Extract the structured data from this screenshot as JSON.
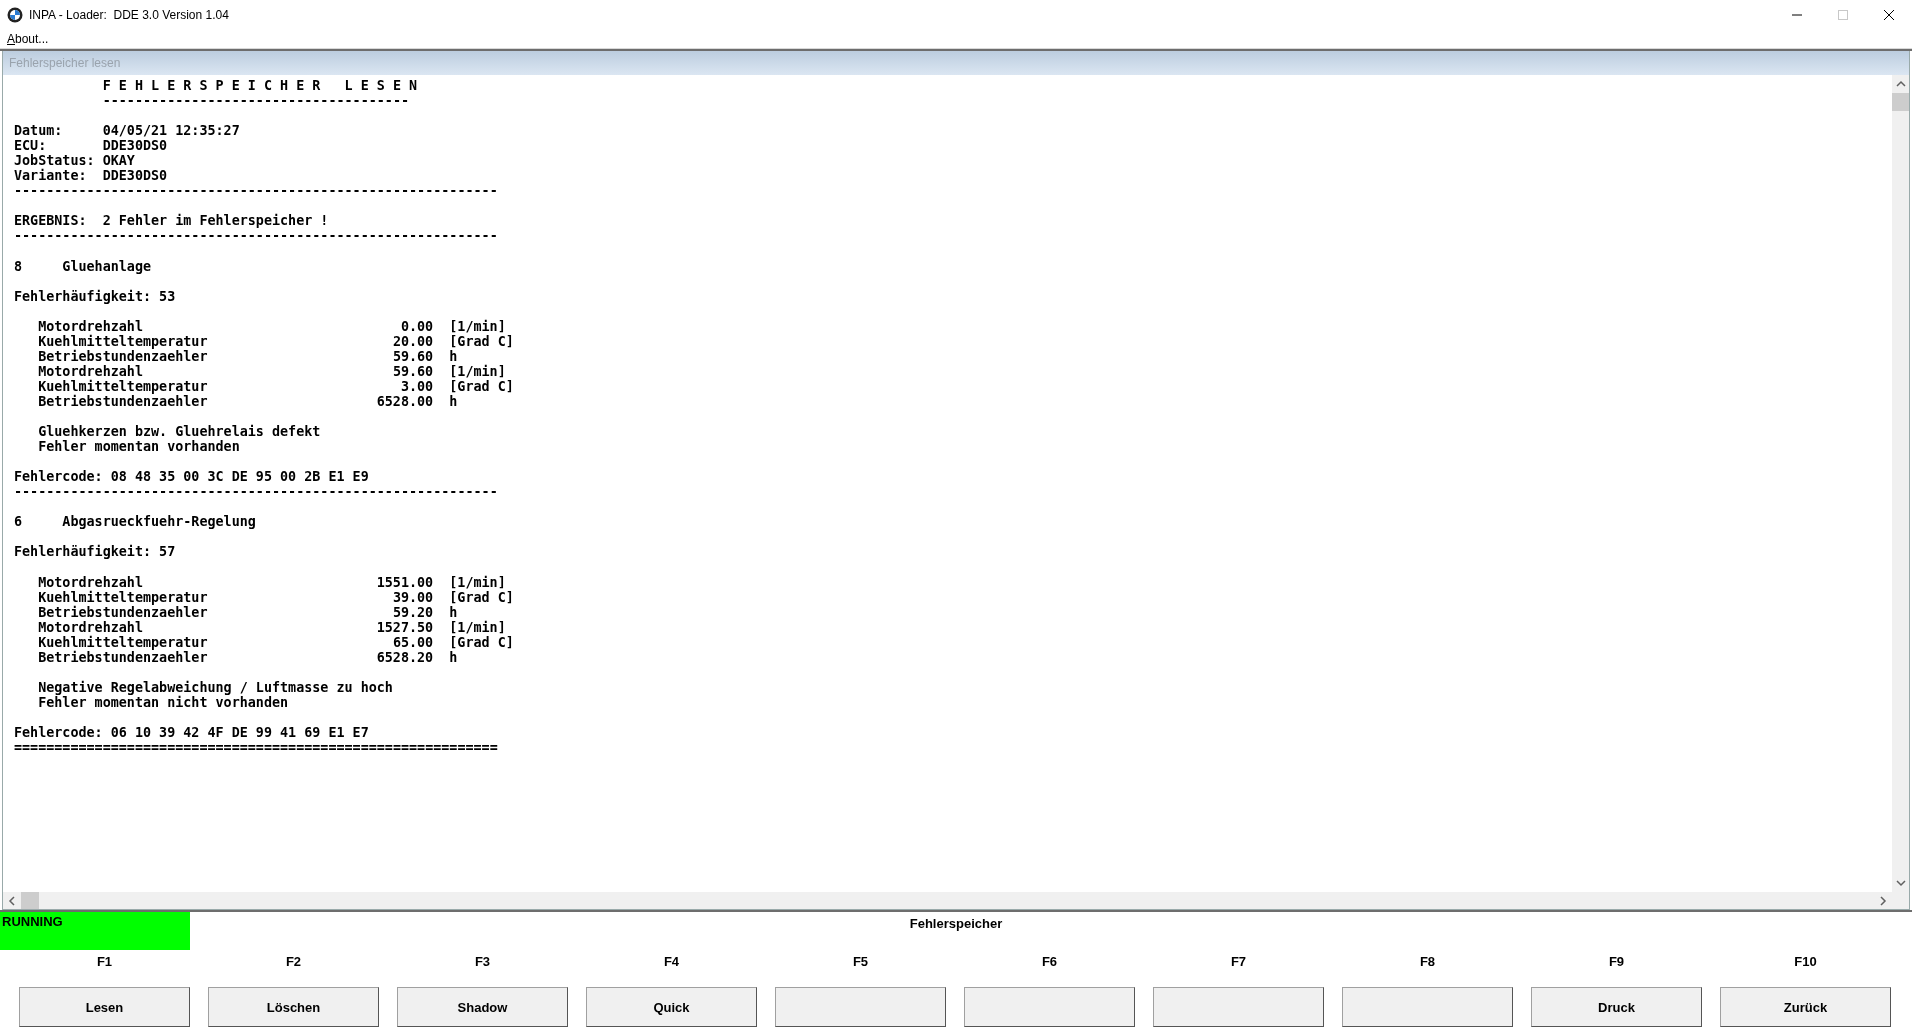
{
  "window": {
    "title": "INPA - Loader:  DDE 3.0 Version 1.04",
    "controls": [
      {
        "kind": "minimize",
        "disabled": false
      },
      {
        "kind": "maximize",
        "disabled": true
      },
      {
        "kind": "close",
        "disabled": false
      }
    ]
  },
  "menu": [
    {
      "label": "About..."
    }
  ],
  "child_window": {
    "title": "Fehlerspeicher lesen",
    "report": [
      {
        "kind": "title",
        "text": "F E H L E R S P E I C H E R   L E S E N"
      },
      {
        "kind": "title",
        "text": "--------------------------------------"
      },
      {
        "kind": "blank"
      },
      {
        "kind": "field",
        "label": "Datum:",
        "value": "04/05/21 12:35:27"
      },
      {
        "kind": "field",
        "label": "ECU:",
        "value": "DDE30DS0"
      },
      {
        "kind": "field",
        "label": "JobStatus:",
        "value": "OKAY"
      },
      {
        "kind": "field",
        "label": "Variante:",
        "value": "DDE30DS0"
      },
      {
        "kind": "line",
        "text": "------------------------------------------------------------"
      },
      {
        "kind": "blank"
      },
      {
        "kind": "field",
        "label": "ERGEBNIS:",
        "value": "2 Fehler im Fehlerspeicher !"
      },
      {
        "kind": "line",
        "text": "------------------------------------------------------------"
      },
      {
        "kind": "blank"
      },
      {
        "kind": "heading",
        "number": "8",
        "name": "Gluehanlage"
      },
      {
        "kind": "blank"
      },
      {
        "kind": "line",
        "text": "Fehlerhäufigkeit: 53"
      },
      {
        "kind": "blank"
      },
      {
        "kind": "param",
        "name": "Motordrehzahl",
        "value": "0.00",
        "unit": "[1/min]"
      },
      {
        "kind": "param",
        "name": "Kuehlmitteltemperatur",
        "value": "20.00",
        "unit": "[Grad C]"
      },
      {
        "kind": "param",
        "name": "Betriebstundenzaehler",
        "value": "59.60",
        "unit": "h"
      },
      {
        "kind": "param",
        "name": "Motordrehzahl",
        "value": "59.60",
        "unit": "[1/min]"
      },
      {
        "kind": "param",
        "name": "Kuehlmitteltemperatur",
        "value": "3.00",
        "unit": "[Grad C]"
      },
      {
        "kind": "param",
        "name": "Betriebstundenzaehler",
        "value": "6528.00",
        "unit": "h"
      },
      {
        "kind": "blank"
      },
      {
        "kind": "note",
        "text": "Gluehkerzen bzw. Gluehrelais defekt"
      },
      {
        "kind": "note",
        "text": "Fehler momentan vorhanden"
      },
      {
        "kind": "blank"
      },
      {
        "kind": "line",
        "text": "Fehlercode: 08 48 35 00 3C DE 95 00 2B E1 E9"
      },
      {
        "kind": "line",
        "text": "------------------------------------------------------------"
      },
      {
        "kind": "blank"
      },
      {
        "kind": "heading",
        "number": "6",
        "name": "Abgasrueckfuehr-Regelung"
      },
      {
        "kind": "blank"
      },
      {
        "kind": "line",
        "text": "Fehlerhäufigkeit: 57"
      },
      {
        "kind": "blank"
      },
      {
        "kind": "param",
        "name": "Motordrehzahl",
        "value": "1551.00",
        "unit": "[1/min]"
      },
      {
        "kind": "param",
        "name": "Kuehlmitteltemperatur",
        "value": "39.00",
        "unit": "[Grad C]"
      },
      {
        "kind": "param",
        "name": "Betriebstundenzaehler",
        "value": "59.20",
        "unit": "h"
      },
      {
        "kind": "param",
        "name": "Motordrehzahl",
        "value": "1527.50",
        "unit": "[1/min]"
      },
      {
        "kind": "param",
        "name": "Kuehlmitteltemperatur",
        "value": "65.00",
        "unit": "[Grad C]"
      },
      {
        "kind": "param",
        "name": "Betriebstundenzaehler",
        "value": "6528.20",
        "unit": "h"
      },
      {
        "kind": "blank"
      },
      {
        "kind": "note",
        "text": "Negative Regelabweichung / Luftmasse zu hoch"
      },
      {
        "kind": "note",
        "text": "Fehler momentan nicht vorhanden"
      },
      {
        "kind": "blank"
      },
      {
        "kind": "line",
        "text": "Fehlercode: 06 10 39 42 4F DE 99 41 69 E1 E7"
      },
      {
        "kind": "line",
        "text": "============================================================"
      }
    ]
  },
  "status": {
    "state": "RUNNING",
    "color": "#00ff00",
    "title": "Fehlerspeicher"
  },
  "function_keys": [
    {
      "key": "F1",
      "label": "Lesen"
    },
    {
      "key": "F2",
      "label": "Löschen"
    },
    {
      "key": "F3",
      "label": "Shadow"
    },
    {
      "key": "F4",
      "label": "Quick"
    },
    {
      "key": "F5"
    },
    {
      "key": "F6"
    },
    {
      "key": "F7"
    },
    {
      "key": "F8"
    },
    {
      "key": "F9",
      "label": "Druck"
    },
    {
      "key": "F10",
      "label": "Zurück"
    }
  ]
}
